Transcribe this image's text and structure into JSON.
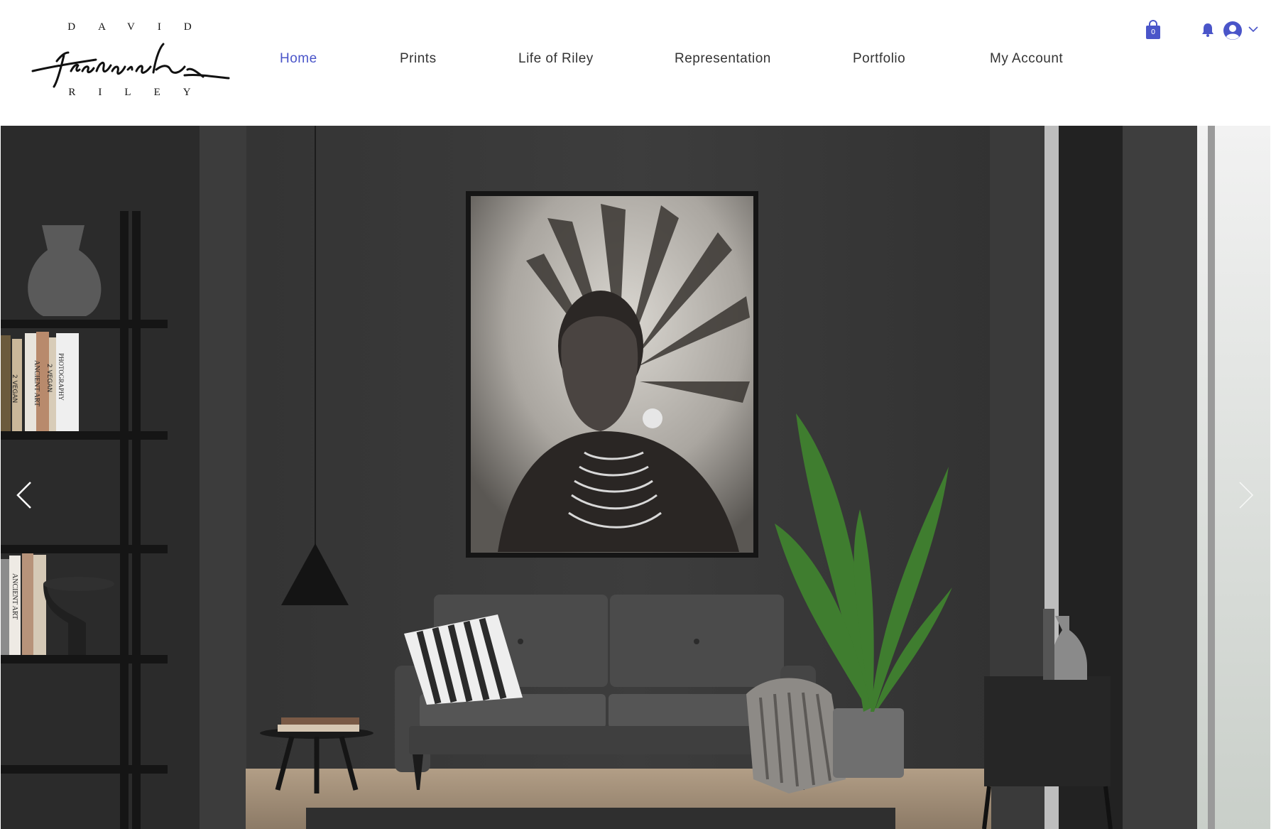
{
  "brand": {
    "top": "DAVID",
    "signature": "Fredrick",
    "bottom": "RILEY"
  },
  "nav": {
    "items": [
      {
        "label": "Home",
        "active": true
      },
      {
        "label": "Prints",
        "active": false
      },
      {
        "label": "Life of Riley",
        "active": false
      },
      {
        "label": "Representation",
        "active": false
      },
      {
        "label": "Portfolio",
        "active": false
      },
      {
        "label": "My Account",
        "active": false
      }
    ]
  },
  "cart": {
    "count": "0",
    "icon": "shopping-bag-icon"
  },
  "icons": {
    "notifications": "bell-icon",
    "account": "user-avatar-icon",
    "account_menu": "chevron-down-icon",
    "prev": "chevron-left-icon",
    "next": "chevron-right-icon"
  },
  "colors": {
    "accent": "#4a55c9",
    "nav_text": "#333333",
    "wall": "#3b3b3b"
  },
  "books": {
    "shelf1": [
      "2 VEGAN",
      "ANCIENT ART",
      "2 VEGAN",
      "PHOTOGRAPHY"
    ],
    "shelf3": [
      "ANCIENT ART"
    ]
  }
}
